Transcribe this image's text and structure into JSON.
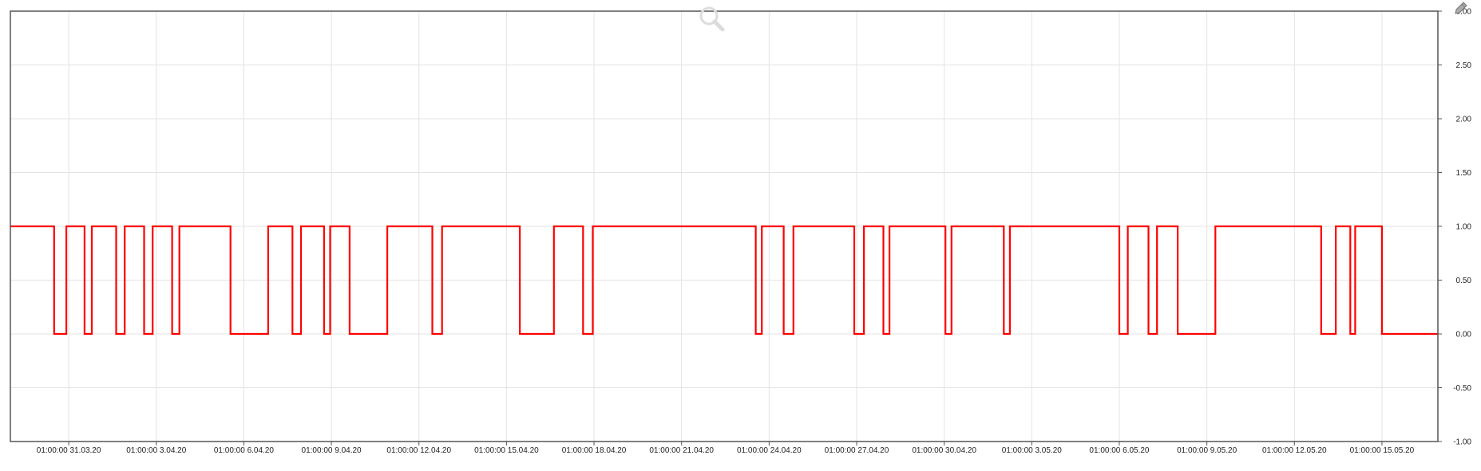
{
  "chart_data": {
    "type": "line",
    "title": "",
    "xlabel": "",
    "ylabel": "",
    "ylim": [
      -1.0,
      3.0
    ],
    "xlim": [
      "2020-03-29 01:00:00",
      "2020-05-16 23:00:00"
    ],
    "grid": true,
    "line_shape": "step",
    "y_ticks": [
      "-1.00",
      "-0.50",
      "0.00",
      "0.50",
      "1.00",
      "1.50",
      "2.00",
      "2.50",
      "3.00"
    ],
    "x_ticks": [
      {
        "x": "2020-03-31 01:00:00",
        "label": "01:00:00 31.03.20"
      },
      {
        "x": "2020-04-03 01:00:00",
        "label": "01:00:00 3.04.20"
      },
      {
        "x": "2020-04-06 01:00:00",
        "label": "01:00:00 6.04.20"
      },
      {
        "x": "2020-04-09 01:00:00",
        "label": "01:00:00 9.04.20"
      },
      {
        "x": "2020-04-12 01:00:00",
        "label": "01:00:00 12.04.20"
      },
      {
        "x": "2020-04-15 01:00:00",
        "label": "01:00:00 15.04.20"
      },
      {
        "x": "2020-04-18 01:00:00",
        "label": "01:00:00 18.04.20"
      },
      {
        "x": "2020-04-21 01:00:00",
        "label": "01:00:00 21.04.20"
      },
      {
        "x": "2020-04-24 01:00:00",
        "label": "01:00:00 24.04.20"
      },
      {
        "x": "2020-04-27 01:00:00",
        "label": "01:00:00 27.04.20"
      },
      {
        "x": "2020-04-30 01:00:00",
        "label": "01:00:00 30.04.20"
      },
      {
        "x": "2020-05-03 01:00:00",
        "label": "01:00:00 3.05.20"
      },
      {
        "x": "2020-05-06 01:00:00",
        "label": "01:00:00 6.05.20"
      },
      {
        "x": "2020-05-09 01:00:00",
        "label": "01:00:00 9.05.20"
      },
      {
        "x": "2020-05-12 01:00:00",
        "label": "01:00:00 12.05.20"
      },
      {
        "x": "2020-05-15 01:00:00",
        "label": "01:00:00 15.05.20"
      }
    ],
    "series": [
      {
        "color": "#ff0000",
        "points": [
          {
            "x": "2020-03-29 01:00:00",
            "y": 1
          },
          {
            "x": "2020-03-30 13:00:00",
            "y": 0
          },
          {
            "x": "2020-03-30 23:00:00",
            "y": 1
          },
          {
            "x": "2020-03-31 14:00:00",
            "y": 0
          },
          {
            "x": "2020-03-31 20:00:00",
            "y": 1
          },
          {
            "x": "2020-04-01 16:00:00",
            "y": 0
          },
          {
            "x": "2020-04-01 23:00:00",
            "y": 1
          },
          {
            "x": "2020-04-02 15:00:00",
            "y": 0
          },
          {
            "x": "2020-04-02 22:00:00",
            "y": 1
          },
          {
            "x": "2020-04-03 14:00:00",
            "y": 0
          },
          {
            "x": "2020-04-03 20:00:00",
            "y": 1
          },
          {
            "x": "2020-04-05 14:00:00",
            "y": 0
          },
          {
            "x": "2020-04-06 21:00:00",
            "y": 1
          },
          {
            "x": "2020-04-07 17:00:00",
            "y": 0
          },
          {
            "x": "2020-04-08 00:00:00",
            "y": 1
          },
          {
            "x": "2020-04-08 19:00:00",
            "y": 0
          },
          {
            "x": "2020-04-09 00:00:00",
            "y": 1
          },
          {
            "x": "2020-04-09 16:00:00",
            "y": 0
          },
          {
            "x": "2020-04-10 23:00:00",
            "y": 1
          },
          {
            "x": "2020-04-12 12:00:00",
            "y": 0
          },
          {
            "x": "2020-04-12 20:00:00",
            "y": 1
          },
          {
            "x": "2020-04-15 12:00:00",
            "y": 0
          },
          {
            "x": "2020-04-16 16:00:00",
            "y": 1
          },
          {
            "x": "2020-04-17 16:00:00",
            "y": 0
          },
          {
            "x": "2020-04-18 00:00:00",
            "y": 1
          },
          {
            "x": "2020-04-23 14:00:00",
            "y": 0
          },
          {
            "x": "2020-04-23 19:00:00",
            "y": 1
          },
          {
            "x": "2020-04-24 13:00:00",
            "y": 0
          },
          {
            "x": "2020-04-24 21:00:00",
            "y": 1
          },
          {
            "x": "2020-04-26 23:00:00",
            "y": 0
          },
          {
            "x": "2020-04-27 07:00:00",
            "y": 1
          },
          {
            "x": "2020-04-27 23:00:00",
            "y": 0
          },
          {
            "x": "2020-04-28 04:00:00",
            "y": 1
          },
          {
            "x": "2020-04-30 02:00:00",
            "y": 0
          },
          {
            "x": "2020-04-30 07:00:00",
            "y": 1
          },
          {
            "x": "2020-05-02 02:00:00",
            "y": 0
          },
          {
            "x": "2020-05-02 07:00:00",
            "y": 1
          },
          {
            "x": "2020-05-06 01:00:00",
            "y": 0
          },
          {
            "x": "2020-05-06 08:00:00",
            "y": 1
          },
          {
            "x": "2020-05-07 01:00:00",
            "y": 0
          },
          {
            "x": "2020-05-07 08:00:00",
            "y": 1
          },
          {
            "x": "2020-05-08 01:00:00",
            "y": 0
          },
          {
            "x": "2020-05-09 08:00:00",
            "y": 1
          },
          {
            "x": "2020-05-12 23:00:00",
            "y": 0
          },
          {
            "x": "2020-05-13 11:00:00",
            "y": 1
          },
          {
            "x": "2020-05-13 23:00:00",
            "y": 0
          },
          {
            "x": "2020-05-14 03:00:00",
            "y": 1
          },
          {
            "x": "2020-05-15 01:00:00",
            "y": 0
          },
          {
            "x": "2020-05-16 23:00:00",
            "y": 0
          }
        ]
      }
    ]
  },
  "icons": {
    "zoom": "magnifier-icon",
    "edit": "pencil-icon"
  }
}
